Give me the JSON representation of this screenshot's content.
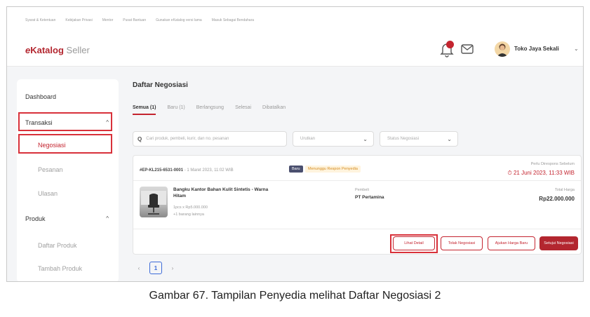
{
  "topbar": {
    "links": [
      "Syarat & Ketentuan",
      "Kebijakan Privasi",
      "Mentor",
      "Pusat Bantuan",
      "Gunakan eKatalog versi lama",
      "Masuk Sebagai Bendahara"
    ]
  },
  "header": {
    "logo_e": "e",
    "logo_katalog": "Katalog",
    "logo_seller": "Seller",
    "store_name": "Toko Jaya Sekali",
    "store_chevron": "⌄"
  },
  "sidebar": {
    "dashboard": "Dashboard",
    "transaksi": "Transaksi",
    "transaksi_chevron": "^",
    "negosiasi": "Negosiasi",
    "pesanan": "Pesanan",
    "ulasan": "Ulasan",
    "produk": "Produk",
    "produk_chevron": "^",
    "daftar_produk": "Daftar Produk",
    "tambah_produk": "Tambah Produk"
  },
  "main": {
    "title": "Daftar Negosiasi",
    "tabs": [
      {
        "label": "Semua (1)"
      },
      {
        "label": "Baru (1)"
      },
      {
        "label": "Berlangsung"
      },
      {
        "label": "Selesai"
      },
      {
        "label": "Dibatalkan"
      }
    ],
    "search_placeholder": "Cari produk, pembeli, kurir, dan no. pesanan",
    "search_icon": "Q",
    "sort_label": "Urutkan",
    "status_label": "Status Negosiasi",
    "select_chevron": "⌄"
  },
  "card": {
    "order_id": "#EP-KL215-6531-0001",
    "order_date": " - 1 Maret 2023, 11:02 WIB",
    "badge_new": "Baru",
    "badge_status": "Menunggu Respon Penyedia",
    "due_label": "Perlu Direspons Sebelum",
    "due_date": "⏱ 21 Juni 2023, 11:33 WIB",
    "product_name": "Bangku Kantor Bahan Kulit Sintetis - Warna Hitam",
    "product_qty": "1pcs x Rp5.000.000",
    "product_more": "+1 barang lainnya",
    "buyer_label": "Pembeli",
    "buyer_name": "PT Pertamina",
    "total_label": "Total Harga",
    "total_value": "Rp22.000.000",
    "btn_detail": "Lihat Detail",
    "btn_reject": "Tolak Negosiasi",
    "btn_propose": "Ajukan Harga Baru",
    "btn_accept": "Setujui Negosiasi"
  },
  "pagination": {
    "prev": "‹",
    "page": "1",
    "next": "›"
  },
  "caption": "Gambar 67. Tampilan Penyedia melihat Daftar Negosiasi 2",
  "colors": {
    "brand_red": "#b3262f",
    "highlight_red": "#d8313a",
    "status_orange": "#d48a1e"
  }
}
